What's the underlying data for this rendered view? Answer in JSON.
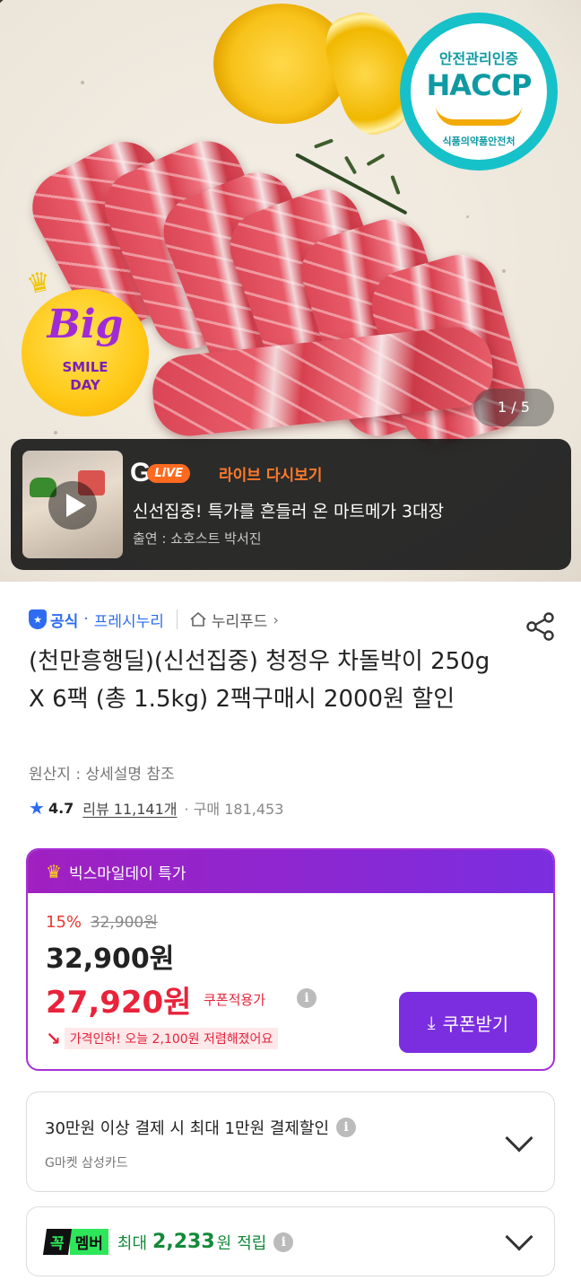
{
  "hero": {
    "haccp": {
      "top": "안전관리인증",
      "main": "HACCP",
      "bottom": "식품의약품안전처"
    },
    "big_smile": {
      "big": "Big",
      "smile": "SMILE",
      "day": "DAY"
    },
    "counter": "1 / 5"
  },
  "live": {
    "g_letter": "G",
    "badge": "LiVE",
    "replay_label": "라이브 다시보기",
    "title": "신선집중! 특가를 흔들러 온 마트메가 3대장",
    "host": "출연 : 쇼호스트 박서진"
  },
  "seller": {
    "official_label": "공식",
    "separator": "·",
    "brand": "프레시누리",
    "store": "누리푸드"
  },
  "product": {
    "title": "(천만흥행딜)(신선집중) 청정우 차돌박이 250g X 6팩 (총 1.5kg) 2팩구매시 2000원 할인",
    "origin": "원산지 : 상세설명 참조",
    "rating": "4.7",
    "review_text": "리뷰 11,141개",
    "purchase_text": "· 구매 181,453"
  },
  "price": {
    "header": "빅스마일데이 특가",
    "discount_rate": "15%",
    "original_price": "32,900원",
    "sale_price": "32,900원",
    "coupon_price": "27,920원",
    "coupon_label": "쿠폰적용가",
    "drop_text": "가격인하! 오늘 2,100원 저렴해졌어요",
    "coupon_button": "쿠폰받기"
  },
  "card_payment": {
    "title": "30만원 이상 결제 시 최대 1만원 결제할인",
    "subtitle": "G마켓 삼성카드"
  },
  "membership": {
    "badge_a": "꼭",
    "badge_b": "멤버",
    "max_label": "최대",
    "amount": "2,233",
    "unit": "원",
    "accrue": "적립"
  },
  "colors": {
    "accent_purple": "#7b2ee0",
    "sale_red": "#e8233a",
    "official_blue": "#2d6cf0",
    "member_green": "#2ee65a"
  }
}
